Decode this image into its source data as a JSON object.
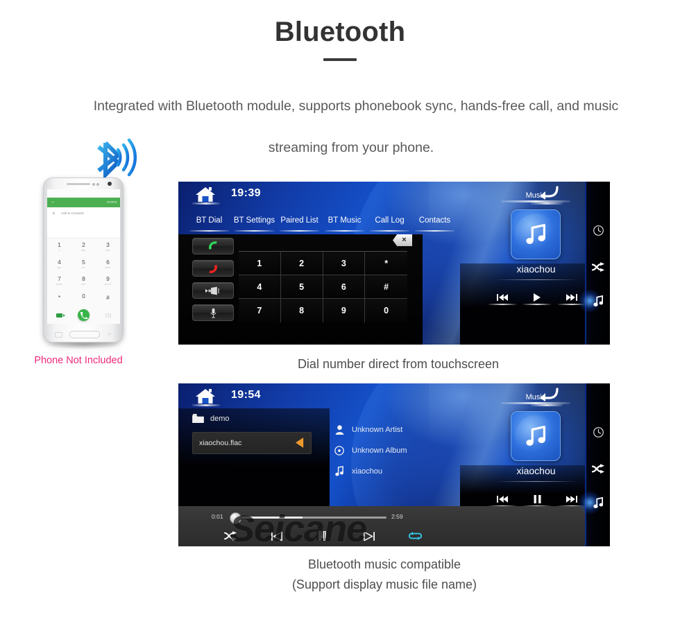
{
  "header": {
    "title": "Bluetooth",
    "subtitle_line1": "Integrated with  Bluetooth module, supports phonebook sync, hands-free call, and music",
    "subtitle_line2": "streaming from your phone."
  },
  "phone": {
    "bluetooth_icon": "bluetooth-icon",
    "not_included_label": "Phone Not Included",
    "not_included_color": "#ee2a7b",
    "appbar": {
      "back_icon": "back-arrow-icon",
      "more_label": "MORE",
      "bar_color": "#4caf50"
    },
    "add_contact_label": "Add to Contacts",
    "keys": [
      {
        "num": "1",
        "sub": "∞"
      },
      {
        "num": "2",
        "sub": "ABC"
      },
      {
        "num": "3",
        "sub": "DEF"
      },
      {
        "num": "4",
        "sub": "GHI"
      },
      {
        "num": "5",
        "sub": "JKL"
      },
      {
        "num": "6",
        "sub": "MNO"
      },
      {
        "num": "7",
        "sub": "PQRS"
      },
      {
        "num": "8",
        "sub": "TUV"
      },
      {
        "num": "9",
        "sub": "WXYZ"
      },
      {
        "num": "*",
        "sub": ""
      },
      {
        "num": "0",
        "sub": "+"
      },
      {
        "num": "#",
        "sub": ""
      }
    ],
    "bottom_row": [
      "videocall-icon",
      "call-icon",
      "keypad-icon"
    ]
  },
  "unit1": {
    "home_icon": "home-icon",
    "clock": "19:39",
    "back_icon": "back-arrow-icon",
    "tabs": [
      {
        "label": "BT Dial"
      },
      {
        "label": "BT Settings"
      },
      {
        "label": "Paired List"
      },
      {
        "label": "BT Music"
      },
      {
        "label": "Call Log"
      },
      {
        "label": "Contacts"
      }
    ],
    "side_buttons": [
      {
        "name": "answer-call-button",
        "icon": "phone-green-icon"
      },
      {
        "name": "end-call-button",
        "icon": "phone-red-icon"
      },
      {
        "name": "audio-transfer-button",
        "icon": "speaker-icon"
      },
      {
        "name": "microphone-button",
        "icon": "microphone-icon"
      }
    ],
    "delete_key": "×",
    "dialpad": [
      "1",
      "2",
      "3",
      "*",
      "4",
      "5",
      "6",
      "#",
      "7",
      "8",
      "9",
      "0"
    ],
    "music": {
      "title": "Music",
      "album_icon": "music-note-icon",
      "track": "xiaochou",
      "prev_icon": "previous-track-icon",
      "play_icon": "play-icon",
      "next_icon": "next-track-icon"
    },
    "rail": [
      {
        "name": "rail-clock-icon"
      },
      {
        "name": "rail-shuffle-icon"
      },
      {
        "name": "rail-music-icon"
      }
    ],
    "caption": "Dial number direct from touchscreen"
  },
  "unit2": {
    "home_icon": "home-icon",
    "clock": "19:54",
    "back_icon": "back-arrow-icon",
    "folder": {
      "icon": "folder-icon",
      "label": "demo"
    },
    "file": {
      "name": "xiaochou.flac",
      "arrow_icon": "left-arrow-icon",
      "arrow_color": "#f09a2e"
    },
    "metadata": [
      {
        "icon": "person-icon",
        "label": "Unknown Artist"
      },
      {
        "icon": "disc-icon",
        "label": "Unknown Album"
      },
      {
        "icon": "note-icon",
        "label": "xiaochou"
      }
    ],
    "player": {
      "elapsed": "0:01",
      "duration": "2:59",
      "progress_percent": 45,
      "shuffle_icon": "shuffle-icon",
      "prev_icon": "previous-icon",
      "pause_icon": "pause-icon",
      "next_icon": "next-icon",
      "repeat_icon": "repeat-icon",
      "repeat_color": "#35c8e8"
    },
    "watermark": "Seicane",
    "music": {
      "title": "Music",
      "album_icon": "music-note-icon",
      "track": "xiaochou",
      "prev_icon": "previous-track-icon",
      "pause_icon": "pause-icon",
      "next_icon": "next-track-icon"
    },
    "rail": [
      {
        "name": "rail-clock-icon"
      },
      {
        "name": "rail-shuffle-icon"
      },
      {
        "name": "rail-music-icon"
      }
    ],
    "caption_line1": "Bluetooth music compatible",
    "caption_line2": "(Support display music file name)"
  }
}
